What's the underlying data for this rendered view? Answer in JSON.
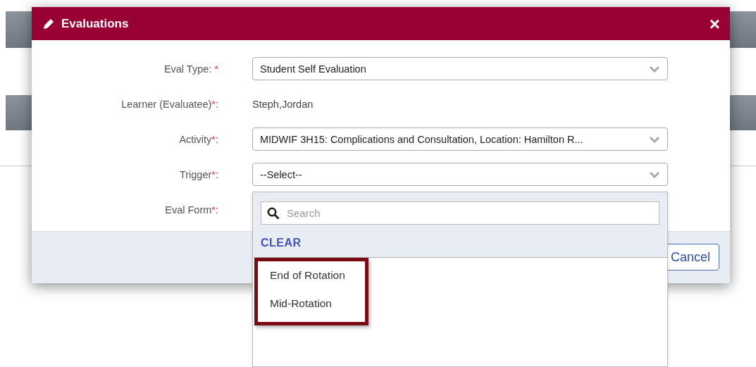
{
  "dialog": {
    "title": "Evaluations",
    "close": "×",
    "fields": [
      {
        "kind": "select",
        "label": "Eval Type: ",
        "mark": "*",
        "value": "Student Self Evaluation"
      },
      {
        "kind": "text",
        "label": "Learner (Evaluatee)",
        "mark": "*",
        "after": ":",
        "value": "Steph,Jordan"
      },
      {
        "kind": "select",
        "label": "Activity",
        "mark": "*",
        "after": ":",
        "value": "MIDWIF 3H15: Complications and Consultation, Location: Hamilton R..."
      },
      {
        "kind": "select",
        "label": "Trigger",
        "mark": "*",
        "after": ":",
        "value": "--Select--"
      },
      {
        "kind": "none",
        "label": "Eval Form",
        "mark": "*",
        "after": ":"
      }
    ],
    "buttons": [
      "Cancel"
    ]
  },
  "dropdown": {
    "search": {
      "placeholder": "Search"
    },
    "clear": "CLEAR",
    "options": [
      {
        "label": "End of Rotation"
      },
      {
        "label": "Mid-Rotation"
      }
    ],
    "highlighted": true
  }
}
